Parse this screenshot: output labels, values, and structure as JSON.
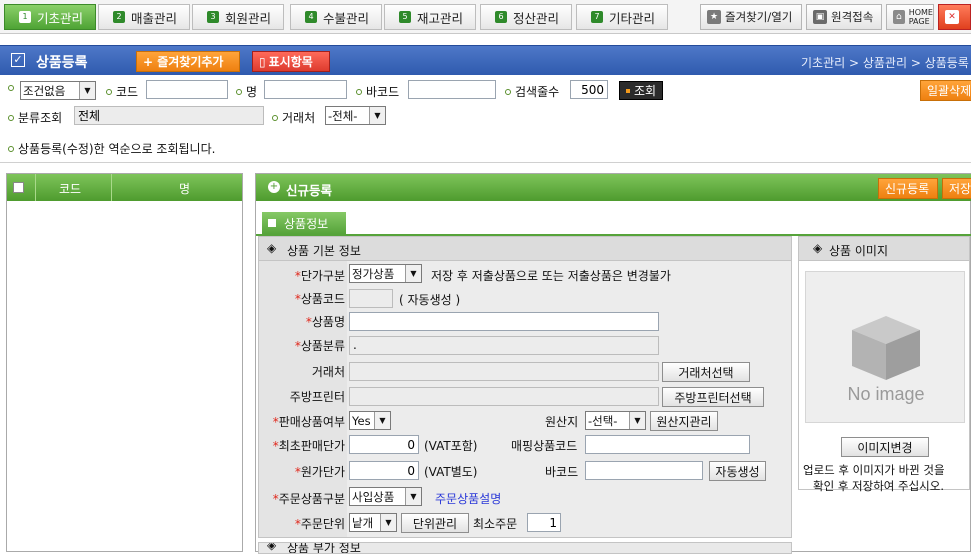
{
  "top_tabs": [
    {
      "num": "1",
      "label": "기초관리",
      "active": true
    },
    {
      "num": "2",
      "label": "매출관리",
      "active": false
    },
    {
      "num": "3",
      "label": "회원관리",
      "active": false
    },
    {
      "num": "4",
      "label": "수불관리",
      "active": false
    },
    {
      "num": "5",
      "label": "재고관리",
      "active": false
    },
    {
      "num": "6",
      "label": "정산관리",
      "active": false
    },
    {
      "num": "7",
      "label": "기타관리",
      "active": false
    }
  ],
  "top_right": {
    "favorites": "즐겨찾기/열기",
    "remote": "원격접속",
    "home": "HOME",
    "home_sub": "PAGE"
  },
  "title": {
    "text": "상품등록",
    "add_favorite": "+ 즐겨찾기추가",
    "display_items": "표시항목",
    "breadcrumb": "기초관리 > 상품관리 > 상품등록"
  },
  "search": {
    "condition_select": "조건없음",
    "code_label": "코드",
    "code_value": "",
    "name_label": "명",
    "name_value": "",
    "barcode_label": "바코드",
    "barcode_value": "",
    "count_label": "검색줄수",
    "count_value": "500",
    "search_button": "조회",
    "bulk_delete": "일괄삭제",
    "category_label": "분류조회",
    "category_value": "전체",
    "vendor_label": "거래처",
    "vendor_select": "-전체-",
    "notice": "상품등록(수정)한 역순으로 조회됩니다."
  },
  "left_table": {
    "col_code": "코드",
    "col_name": "명"
  },
  "right": {
    "header_title": "신규등록",
    "new_button": "신규등록",
    "save_button": "저장",
    "product_tab": "상품정보",
    "basic_section": "상품 기본 정보",
    "image_section": "상품 이미지",
    "price_type_label": "단가구분",
    "price_type_value": "정가상품",
    "price_type_note": "저장 후 저출상품으로 또는 저출상품은 변경불가",
    "code_label": "상품코드",
    "code_note": "( 자동생성 )",
    "name_label": "상품명",
    "name_value": "",
    "category_label": "상품분류",
    "category_value": ".",
    "vendor_label": "거래처",
    "vendor_button": "거래처선택",
    "printer_label": "주방프린터",
    "printer_button": "주방프린터선택",
    "for_sale_label": "판매상품여부",
    "for_sale_value": "Yes",
    "origin_label": "원산지",
    "origin_value": "-선택-",
    "origin_button": "원산지관리",
    "min_price_label": "최초판매단가",
    "min_price_value": "0",
    "min_price_unit": "(VAT포함)",
    "matching_label": "매핑상품코드",
    "matching_value": "",
    "cost_label": "원가단가",
    "cost_value": "0",
    "cost_unit": "(VAT별도)",
    "barcode_label": "바코드",
    "barcode_value": "",
    "autogen_button": "자동생성",
    "order_type_label": "주문상품구분",
    "order_type_value": "사입상품",
    "order_type_link": "주문상품설명",
    "order_unit_label": "주문단위",
    "order_unit_value": "낱개",
    "unit_button": "단위관리",
    "min_order_label": "최소주문",
    "min_order_value": "1",
    "image_change_button": "이미지변경",
    "image_note1": "업로드 후 이미지가 바뀐 것을",
    "image_note2": "확인 후 저장하여 주십시오.",
    "no_image": "No image",
    "extra_section": "상품 부가 정보"
  }
}
